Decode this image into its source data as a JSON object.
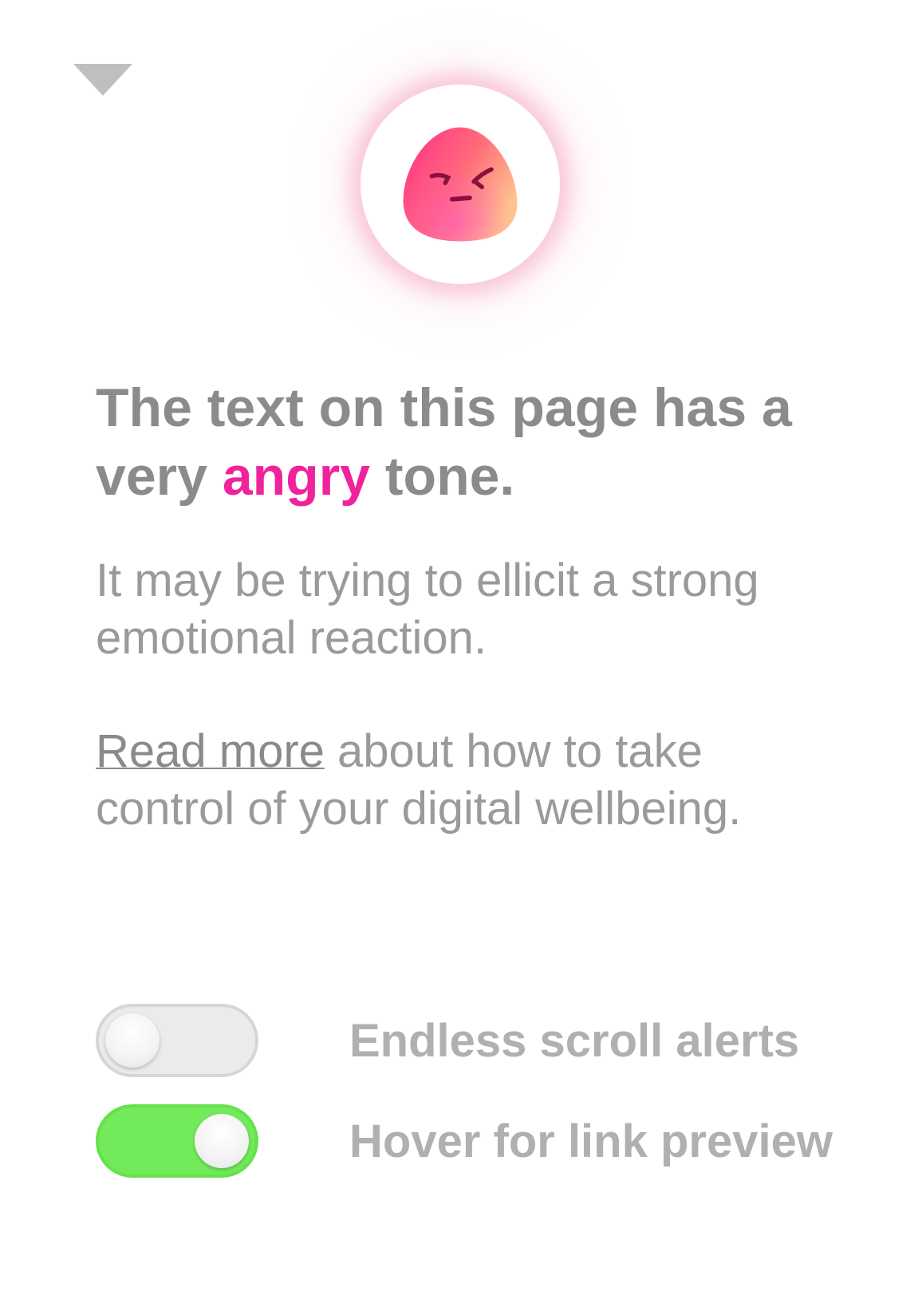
{
  "header": {
    "collapse_icon": "triangle-down-icon"
  },
  "emotion": {
    "icon": "angry-face-icon",
    "colors": {
      "gradient_start": "#ff2d8a",
      "gradient_mid": "#ff6a7a",
      "gradient_end": "#ffc38f",
      "feature": "#8a1040"
    }
  },
  "message": {
    "headline_before": "The text on this page has a very ",
    "tone": "angry",
    "headline_after": " tone.",
    "tone_color": "#f0239c",
    "subtext": "It may be trying to ellicit a strong emotional reaction.",
    "read_more_link": "Read more",
    "read_more_after": " about how to take control of your digital wellbeing."
  },
  "settings": [
    {
      "label": "Endless scroll alerts",
      "enabled": false
    },
    {
      "label": "Hover for link preview",
      "enabled": true
    }
  ]
}
